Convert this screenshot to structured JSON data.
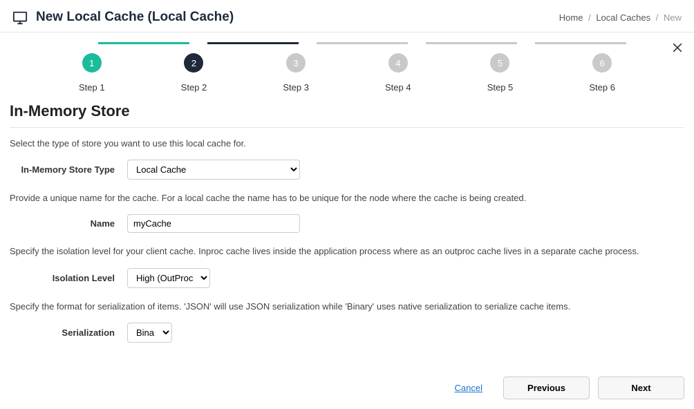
{
  "header": {
    "title": "New Local Cache (Local Cache)",
    "breadcrumb": {
      "home": "Home",
      "local_caches": "Local Caches",
      "current": "New"
    }
  },
  "stepper": {
    "steps": [
      {
        "num": "1",
        "label": "Step 1",
        "state": "done"
      },
      {
        "num": "2",
        "label": "Step 2",
        "state": "active"
      },
      {
        "num": "3",
        "label": "Step 3",
        "state": "pending"
      },
      {
        "num": "4",
        "label": "Step 4",
        "state": "pending"
      },
      {
        "num": "5",
        "label": "Step 5",
        "state": "pending"
      },
      {
        "num": "6",
        "label": "Step 6",
        "state": "pending"
      }
    ]
  },
  "section": {
    "title": "In-Memory Store",
    "desc_store": "Select the type of store you want to use this local cache for.",
    "label_store_type": "In-Memory Store Type",
    "store_type_value": "Local Cache",
    "desc_name": "Provide a unique name for the cache. For a local cache the name has to be unique for the node where the cache is being created.",
    "label_name": "Name",
    "name_value": "myCache",
    "desc_isolation": "Specify the isolation level for your client cache. Inproc cache lives inside the application process where as an outproc cache lives in a separate cache process.",
    "label_isolation": "Isolation Level",
    "isolation_value": "High (OutProc)",
    "desc_serialization": "Specify the format for serialization of items. 'JSON' will use JSON serialization while 'Binary' uses native serialization to serialize cache items.",
    "label_serialization": "Serialization",
    "serialization_value": "Binary"
  },
  "footer": {
    "cancel": "Cancel",
    "previous": "Previous",
    "next": "Next"
  }
}
